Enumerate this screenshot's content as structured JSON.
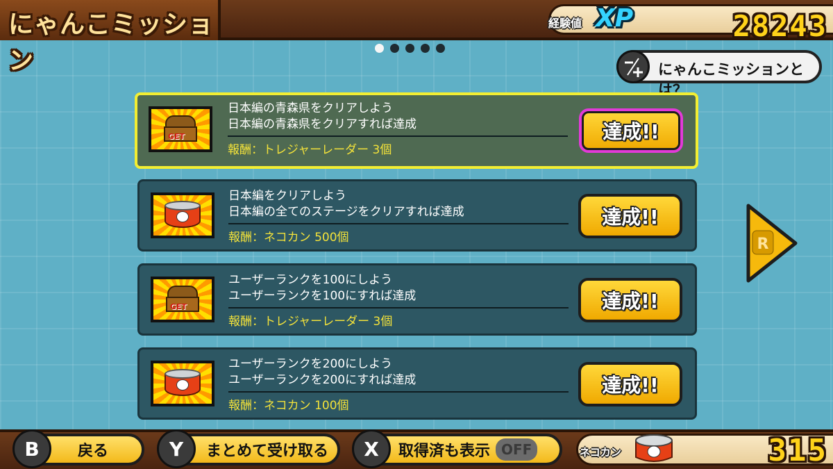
{
  "header": {
    "title": "にゃんこミッション",
    "xp_small_label": "経験値",
    "xp_label": "XP",
    "xp_value": "28243"
  },
  "pagination": {
    "total": 5,
    "active_index": 0
  },
  "help": {
    "icon": "",
    "label": "にゃんこミッションとは？"
  },
  "missions": [
    {
      "title": "日本編の青森県をクリアしよう",
      "description": "日本編の青森県をクリアすれば達成",
      "reward": "報酬：トレジャーレーダー 3個",
      "icon": "treasure-chest-icon",
      "button": "達成!!",
      "selected": true
    },
    {
      "title": "日本編をクリアしよう",
      "description": "日本編の全てのステージをクリアすれば達成",
      "reward": "報酬：ネコカン 500個",
      "icon": "cat-food-can-icon",
      "button": "達成!!",
      "selected": false
    },
    {
      "title": "ユーザーランクを100にしよう",
      "description": "ユーザーランクを100にすれば達成",
      "reward": "報酬：トレジャーレーダー 3個",
      "icon": "treasure-chest-icon",
      "button": "達成!!",
      "selected": false
    },
    {
      "title": "ユーザーランクを200にしよう",
      "description": "ユーザーランクを200にすれば達成",
      "reward": "報酬：ネコカン 100個",
      "icon": "cat-food-can-icon",
      "button": "達成!!",
      "selected": false
    }
  ],
  "next_arrow": {
    "key": "R"
  },
  "footer": {
    "back": {
      "key": "B",
      "label": "戻る"
    },
    "collect_all": {
      "key": "Y",
      "label": "まとめて受け取る"
    },
    "show_claimed": {
      "key": "X",
      "label": "取得済も表示",
      "toggle": "OFF"
    },
    "currency_label": "ネコカン",
    "currency_value": "315"
  },
  "colors": {
    "accent_yellow": "#ffd21a",
    "selected_border": "#f3ee32",
    "focus_border": "#e23ad8",
    "card_bg": "#2d5763",
    "reward_text": "#f3e23a"
  }
}
